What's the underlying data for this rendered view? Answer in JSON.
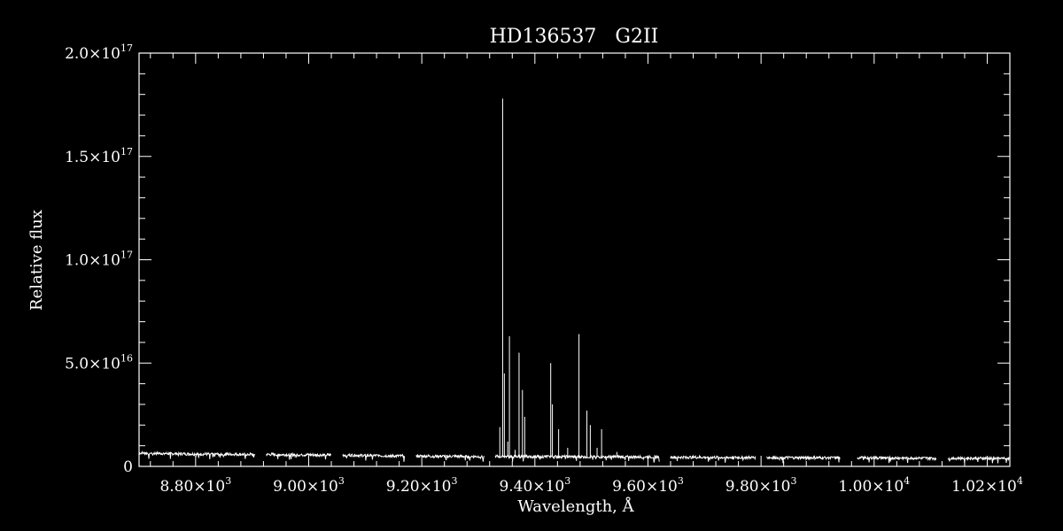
{
  "chart_data": {
    "type": "line",
    "title": "HD136537   G2II",
    "xlabel": "Wavelength, Å",
    "ylabel": "Relative flux",
    "xlim": [
      8700,
      10240
    ],
    "ylim": [
      0,
      2e+17
    ],
    "x_ticks": [
      {
        "value": 8800,
        "mantissa": "8.80",
        "exp": "3"
      },
      {
        "value": 9000,
        "mantissa": "9.00",
        "exp": "3"
      },
      {
        "value": 9200,
        "mantissa": "9.20",
        "exp": "3"
      },
      {
        "value": 9400,
        "mantissa": "9.40",
        "exp": "3"
      },
      {
        "value": 9600,
        "mantissa": "9.60",
        "exp": "3"
      },
      {
        "value": 9800,
        "mantissa": "9.80",
        "exp": "3"
      },
      {
        "value": 10000,
        "mantissa": "1.00",
        "exp": "4"
      },
      {
        "value": 10200,
        "mantissa": "1.02",
        "exp": "4"
      }
    ],
    "y_ticks": [
      {
        "value": 0,
        "mantissa": "0",
        "exp": ""
      },
      {
        "value": 5e+16,
        "mantissa": "5.0",
        "exp": "16"
      },
      {
        "value": 1e+17,
        "mantissa": "1.0",
        "exp": "17"
      },
      {
        "value": 1.5e+17,
        "mantissa": "1.5",
        "exp": "17"
      },
      {
        "value": 2e+17,
        "mantissa": "2.0",
        "exp": "17"
      }
    ],
    "continuum_segments": [
      {
        "x": [
          8700,
          8800
        ],
        "y": [
          6500000000000000.0,
          6000000000000000.0
        ]
      },
      {
        "x": [
          8800,
          8905
        ],
        "y": [
          6000000000000000.0,
          5800000000000000.0
        ]
      },
      {
        "x": [
          8925,
          9040
        ],
        "y": [
          5800000000000000.0,
          5500000000000000.0
        ]
      },
      {
        "x": [
          9060,
          9170
        ],
        "y": [
          5500000000000000.0,
          5000000000000000.0
        ]
      },
      {
        "x": [
          9190,
          9310
        ],
        "y": [
          5000000000000000.0,
          4800000000000000.0
        ]
      },
      {
        "x": [
          9330,
          9620
        ],
        "y": [
          4800000000000000.0,
          4600000000000000.0
        ]
      },
      {
        "x": [
          9640,
          9790
        ],
        "y": [
          4500000000000000.0,
          4300000000000000.0
        ]
      },
      {
        "x": [
          9810,
          9940
        ],
        "y": [
          4300000000000000.0,
          4200000000000000.0
        ]
      },
      {
        "x": [
          9970,
          10110
        ],
        "y": [
          4200000000000000.0,
          4000000000000000.0
        ]
      },
      {
        "x": [
          10130,
          10240
        ],
        "y": [
          4000000000000000.0,
          3900000000000000.0
        ]
      }
    ],
    "spikes": [
      {
        "x": 9338,
        "y": 1.9e+16
      },
      {
        "x": 9343,
        "y": 1.78e+17
      },
      {
        "x": 9346,
        "y": 4.5e+16
      },
      {
        "x": 9352,
        "y": 1.2e+16
      },
      {
        "x": 9355,
        "y": 6.3e+16
      },
      {
        "x": 9365,
        "y": 8000000000000000.0
      },
      {
        "x": 9372,
        "y": 5.5e+16
      },
      {
        "x": 9378,
        "y": 3.7e+16
      },
      {
        "x": 9382,
        "y": 2.4e+16
      },
      {
        "x": 9428,
        "y": 5e+16
      },
      {
        "x": 9431,
        "y": 3e+16
      },
      {
        "x": 9442,
        "y": 1.8e+16
      },
      {
        "x": 9458,
        "y": 9000000000000000.0
      },
      {
        "x": 9478,
        "y": 6.4e+16
      },
      {
        "x": 9492,
        "y": 2.7e+16
      },
      {
        "x": 9498,
        "y": 2e+16
      },
      {
        "x": 9510,
        "y": 9000000000000000.0
      },
      {
        "x": 9518,
        "y": 1.8e+16
      },
      {
        "x": 9545,
        "y": 7000000000000000.0
      }
    ]
  }
}
